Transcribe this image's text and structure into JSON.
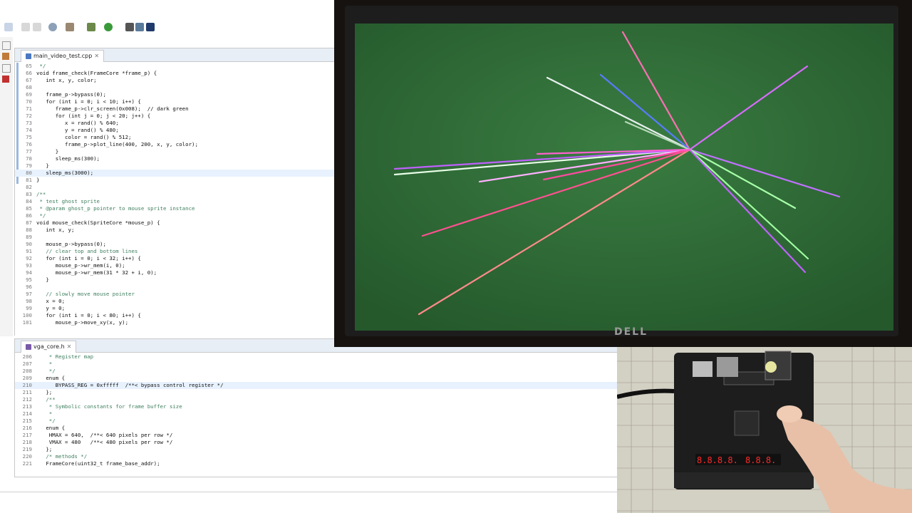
{
  "editor_top": {
    "tab_label": "main_video_test.cpp",
    "lines": [
      {
        "n": "65",
        "t": " */"
      },
      {
        "n": "66",
        "t": "void frame_check(FrameCore *frame_p) {"
      },
      {
        "n": "67",
        "t": "   int x, y, color;"
      },
      {
        "n": "68",
        "t": ""
      },
      {
        "n": "69",
        "t": "   frame_p->bypass(0);"
      },
      {
        "n": "70",
        "t": "   for (int i = 0; i < 10; i++) {"
      },
      {
        "n": "71",
        "t": "      frame_p->clr_screen(0x008);  // dark green"
      },
      {
        "n": "72",
        "t": "      for (int j = 0; j < 20; j++) {"
      },
      {
        "n": "73",
        "t": "         x = rand() % 640;"
      },
      {
        "n": "74",
        "t": "         y = rand() % 480;"
      },
      {
        "n": "75",
        "t": "         color = rand() % 512;"
      },
      {
        "n": "76",
        "t": "         frame_p->plot_line(400, 200, x, y, color);"
      },
      {
        "n": "77",
        "t": "      }"
      },
      {
        "n": "78",
        "t": "      sleep_ms(300);"
      },
      {
        "n": "79",
        "t": "   }"
      },
      {
        "n": "80",
        "t": "   sleep_ms(3000);"
      },
      {
        "n": "81",
        "t": "}"
      },
      {
        "n": "82",
        "t": ""
      },
      {
        "n": "83",
        "t": "/**"
      },
      {
        "n": "84",
        "t": " * test ghost sprite"
      },
      {
        "n": "85",
        "t": " * @param ghost_p pointer to mouse sprite instance"
      },
      {
        "n": "86",
        "t": " */"
      },
      {
        "n": "87",
        "t": "void mouse_check(SpriteCore *mouse_p) {"
      },
      {
        "n": "88",
        "t": "   int x, y;"
      },
      {
        "n": "89",
        "t": ""
      },
      {
        "n": "90",
        "t": "   mouse_p->bypass(0);"
      },
      {
        "n": "91",
        "t": "   // clear top and bottom lines"
      },
      {
        "n": "92",
        "t": "   for (int i = 0; i < 32; i++) {"
      },
      {
        "n": "93",
        "t": "      mouse_p->wr_mem(i, 0);"
      },
      {
        "n": "94",
        "t": "      mouse_p->wr_mem(31 * 32 + i, 0);"
      },
      {
        "n": "95",
        "t": "   }"
      },
      {
        "n": "96",
        "t": ""
      },
      {
        "n": "97",
        "t": "   // slowly move mouse pointer"
      },
      {
        "n": "98",
        "t": "   x = 0;"
      },
      {
        "n": "99",
        "t": "   y = 0;"
      },
      {
        "n": "100",
        "t": "   for (int i = 0; i < 80; i++) {"
      },
      {
        "n": "101",
        "t": "      mouse_p->move_xy(x, y);"
      }
    ]
  },
  "editor_bottom": {
    "tab_label": "vga_core.h",
    "lines": [
      {
        "n": "206",
        "t": "    * Register map"
      },
      {
        "n": "207",
        "t": "    *"
      },
      {
        "n": "208",
        "t": "    */"
      },
      {
        "n": "209",
        "t": "   enum {"
      },
      {
        "n": "210",
        "t": "      BYPASS_REG = 0xfffff  /**< bypass control register */"
      },
      {
        "n": "211",
        "t": "   };"
      },
      {
        "n": "212",
        "t": "   /**"
      },
      {
        "n": "213",
        "t": "    * Symbolic constants for frame buffer size"
      },
      {
        "n": "214",
        "t": "    *"
      },
      {
        "n": "215",
        "t": "    */"
      },
      {
        "n": "216",
        "t": "   enum {"
      },
      {
        "n": "217",
        "t": "    HMAX = 640,  /**< 640 pixels per row */"
      },
      {
        "n": "218",
        "t": "    VMAX = 480   /**< 480 pixels per row */"
      },
      {
        "n": "219",
        "t": "   };"
      },
      {
        "n": "220",
        "t": "   /* methods */"
      },
      {
        "n": "221",
        "t": "   FrameCore(uint32_t frame_base_addr);"
      }
    ]
  },
  "monitor": {
    "brand": "DELL",
    "screen_color": "#2c6b35"
  },
  "colors": {
    "keyword": "#7f0055",
    "comment": "#3f7f5f",
    "selection": "#3875d7"
  }
}
